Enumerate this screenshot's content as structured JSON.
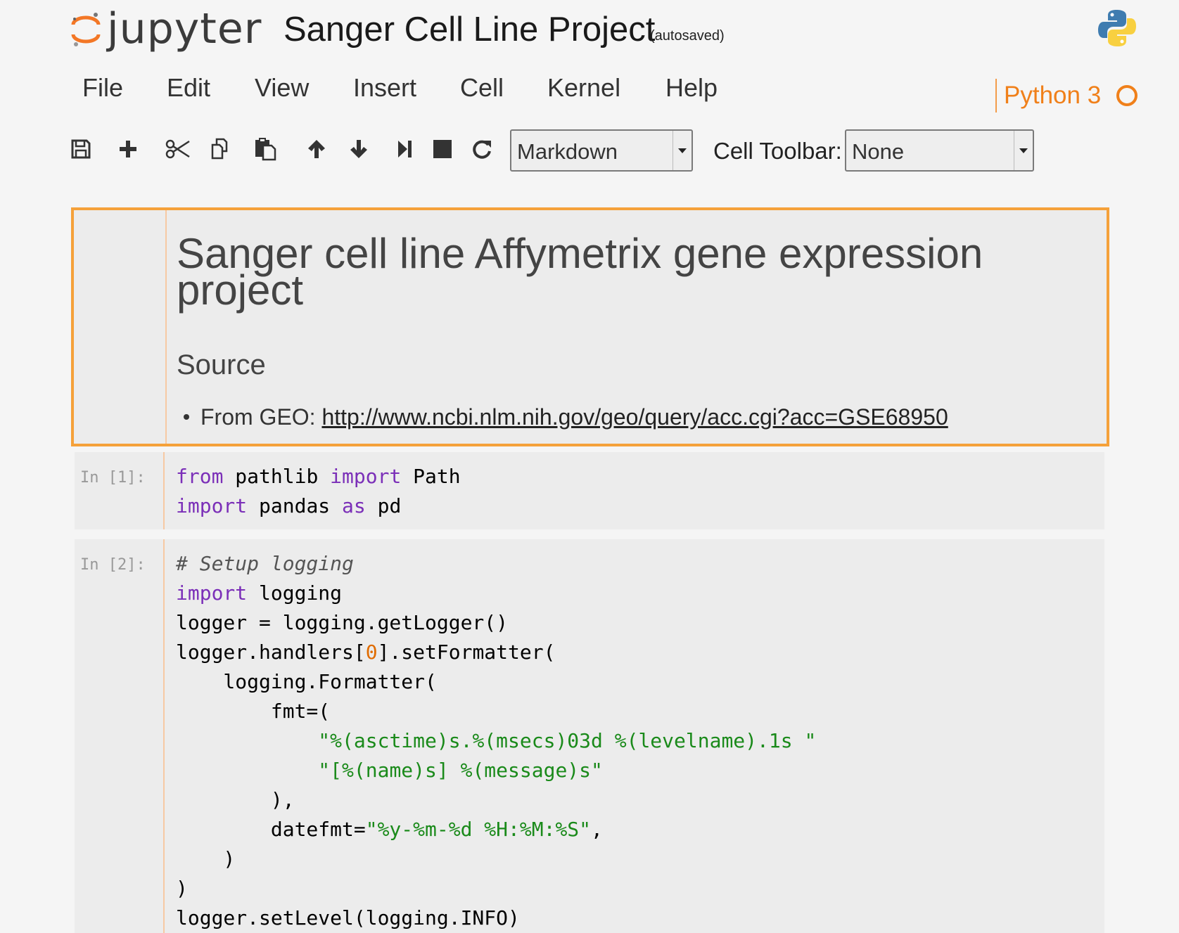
{
  "header": {
    "logo_text": "jupyter",
    "title": "Sanger Cell Line Project",
    "autosave": "(autosaved)",
    "kernel_logo": "python-logo-icon"
  },
  "menu": [
    "File",
    "Edit",
    "View",
    "Insert",
    "Cell",
    "Kernel",
    "Help"
  ],
  "kernel": {
    "name": "Python 3",
    "status_icon": "kernel-idle-circle-icon"
  },
  "toolbar": {
    "buttons": [
      "save-icon",
      "plus-icon",
      "scissors-icon",
      "copy-icon",
      "paste-icon",
      "arrow-up-icon",
      "arrow-down-icon",
      "step-forward-icon",
      "stop-icon",
      "restart-icon"
    ],
    "cell_type": "Markdown",
    "cell_toolbar_label": "Cell Toolbar:",
    "cell_toolbar_value": "None"
  },
  "cells": {
    "markdown": {
      "h1": "Sanger cell line Affymetrix gene expression project",
      "h2": "Source",
      "li_prefix": "From GEO: ",
      "li_link": "http://www.ncbi.nlm.nih.gov/geo/query/acc.cgi?acc=GSE68950"
    },
    "code1": {
      "prompt": "In [1]:"
    },
    "code2": {
      "prompt": "In [2]:"
    }
  },
  "colors": {
    "accent": "#f0801a",
    "selected_border": "#f5a13a",
    "keyword": "#7b2fb8",
    "string": "#1a8a1a"
  }
}
